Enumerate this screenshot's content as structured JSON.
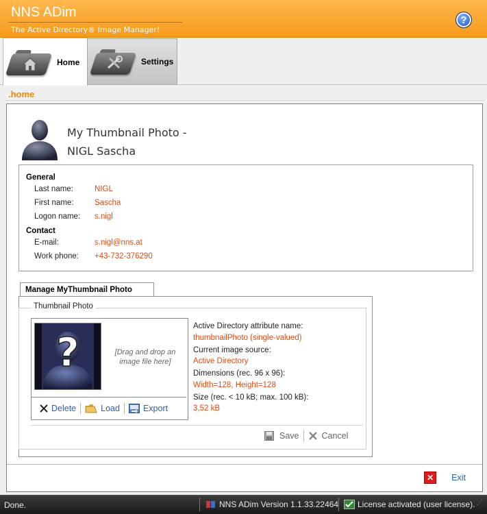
{
  "window": {
    "app_title": "NNS ADim",
    "subtitle": "The Active Directory® Image Manager!",
    "help_label": "?"
  },
  "tabs": [
    {
      "label": "Home",
      "icon": "house-folder-icon",
      "active": true
    },
    {
      "label": "Settings",
      "icon": "tools-folder-icon",
      "active": false
    }
  ],
  "page_label": ".home",
  "header": {
    "title_line1": "My Thumbnail Photo -",
    "title_line2": "NIGL Sascha"
  },
  "general": {
    "heading": "General",
    "fields": [
      {
        "label": "Last name:",
        "value": "NIGL"
      },
      {
        "label": "First name:",
        "value": "Sascha"
      },
      {
        "label": "Logon name:",
        "value": "s.nigl"
      }
    ]
  },
  "contact": {
    "heading": "Contact",
    "fields": [
      {
        "label": "E-mail:",
        "value": "s.nigl@nns.at"
      },
      {
        "label": "Work phone:",
        "value": "+43-732-376290"
      }
    ]
  },
  "manage": {
    "tab_label": "Manage MyThumbnail Photo",
    "legend": "Thumbnail Photo",
    "drop_hint": "[Drag and drop an image file here]",
    "actions": {
      "delete": "Delete",
      "load": "Load",
      "export": "Export"
    },
    "attributes": [
      {
        "label": "Active Directory attribute name:",
        "value": "thumbnailPhoto (single-valued)"
      },
      {
        "label": "Current image source:",
        "value": "Active Directory"
      },
      {
        "label": "Dimensions (rec. 96 x 96):",
        "value": "Width=128, Height=128"
      },
      {
        "label": "Size (rec. < 10 kB; max. 100 kB):",
        "value": "3,52 kB"
      }
    ],
    "save_label": "Save",
    "cancel_label": "Cancel"
  },
  "exit_label": "Exit",
  "status": {
    "left": "Done.",
    "version": "NNS ADim Version 1.1.33.22464",
    "license": "License activated (user license)."
  },
  "colors": {
    "accent": "#f59a1b",
    "value_text": "#e04a10",
    "link_text": "#2b5fb4"
  }
}
